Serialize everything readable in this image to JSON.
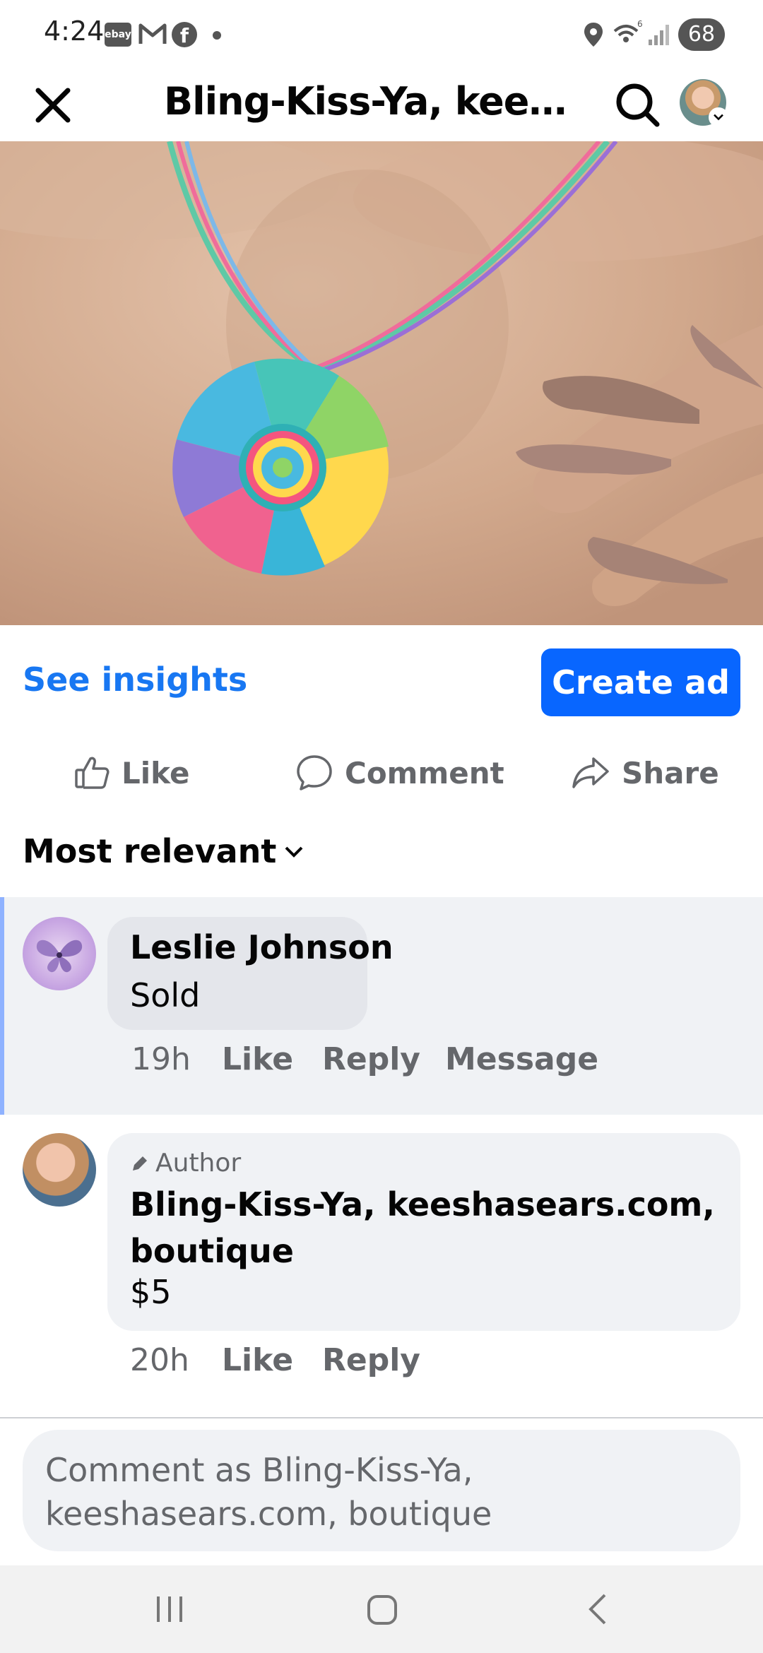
{
  "status_bar": {
    "time": "4:24",
    "ebay_label": "ebay",
    "battery": "68",
    "icons": [
      "ebay-icon",
      "gmail-icon",
      "facebook-icon",
      "notification-dot",
      "location-icon",
      "wifi-icon",
      "signal-icon",
      "battery-icon"
    ]
  },
  "header": {
    "title": "Bling-Kiss-Ya, keeshasears.com, boutique",
    "icons": [
      "close-icon",
      "search-icon",
      "profile-avatar"
    ]
  },
  "image": {
    "description_icon": "product-photo"
  },
  "insights": {
    "see_insights": "See insights",
    "create_ad": "Create ad"
  },
  "actions": {
    "like": "Like",
    "comment": "Comment",
    "share": "Share"
  },
  "sort": {
    "label": "Most relevant"
  },
  "comments": [
    {
      "name": "Leslie Johnson",
      "text": "Sold",
      "time": "19h",
      "like": "Like",
      "reply": "Reply",
      "message": "Message"
    },
    {
      "badge": "Author",
      "name": "Bling-Kiss-Ya, keeshasears.com, boutique",
      "text": "$5",
      "time": "20h",
      "like": "Like",
      "reply": "Reply"
    }
  ],
  "comment_input": {
    "placeholder": "Comment as Bling-Kiss-Ya, keeshasears.com, boutique"
  },
  "colors": {
    "accent": "#1877f2",
    "button": "#0866ff",
    "bubble": "#e4e6eb",
    "muted": "#65676b"
  }
}
